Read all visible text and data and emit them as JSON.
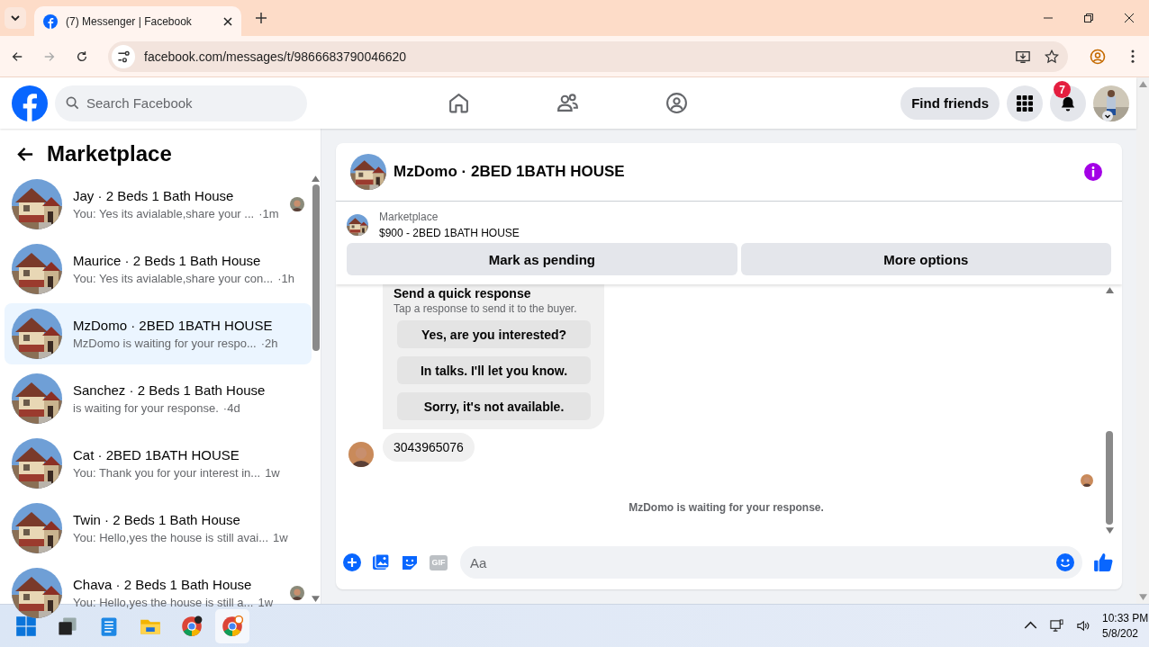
{
  "browser": {
    "tabs": [
      {
        "title": "(7) Messenger | Facebook",
        "selected": true
      }
    ],
    "url": "facebook.com/messages/t/9866683790046620",
    "forward_disabled": true
  },
  "header": {
    "search_placeholder": "Search Facebook",
    "find_friends": "Find friends",
    "notification_count": "7"
  },
  "sidebar": {
    "title": "Marketplace",
    "conversations": [
      {
        "title": "Jay · 2 Beds 1 Bath House",
        "snippet": "You: Yes its avialable,share your ...",
        "time": "·1m",
        "selected": false,
        "seen_avatar": true
      },
      {
        "title": "Maurice · 2 Beds 1 Bath House",
        "snippet": "You: Yes its avialable,share your con...",
        "time": "·1h",
        "selected": false,
        "seen_avatar": false
      },
      {
        "title": "MzDomo · 2BED 1BATH HOUSE",
        "snippet": "MzDomo is waiting for your respo...",
        "time": "·2h",
        "selected": true,
        "seen_avatar": false
      },
      {
        "title": "Sanchez · 2 Beds 1 Bath House",
        "snippet": "is waiting for your response.",
        "time": "·4d",
        "selected": false,
        "seen_avatar": false
      },
      {
        "title": "Cat · 2BED 1BATH HOUSE",
        "snippet": "You: Thank you for your interest in...",
        "time": "1w",
        "selected": false,
        "seen_avatar": false
      },
      {
        "title": "Twin · 2 Beds 1 Bath House",
        "snippet": "You: Hello,yes the house is still avai...",
        "time": "1w",
        "selected": false,
        "seen_avatar": false
      },
      {
        "title": "Chava · 2 Beds 1 Bath House",
        "snippet": "You: Hello,yes the house is still a...",
        "time": "1w",
        "selected": false,
        "seen_avatar": true
      }
    ]
  },
  "chat": {
    "title": "MzDomo · 2BED 1BATH HOUSE",
    "listing": {
      "source": "Marketplace",
      "price_title": "$900 - 2BED 1BATH HOUSE"
    },
    "actions": [
      "Mark as pending",
      "More options"
    ],
    "quick_response": {
      "title": "Send a quick response",
      "subtitle": "Tap a response to send it to the buyer.",
      "options": [
        "Yes, are you interested?",
        "In talks. I'll let you know.",
        "Sorry, it's not available."
      ]
    },
    "messages": [
      {
        "text": "3043965076"
      }
    ],
    "status": "MzDomo is waiting for your response.",
    "composer": {
      "placeholder": "Aa",
      "gif_label": "GIF"
    }
  },
  "taskbar": {
    "time": "10:33 PM",
    "date": "5/8/202"
  }
}
